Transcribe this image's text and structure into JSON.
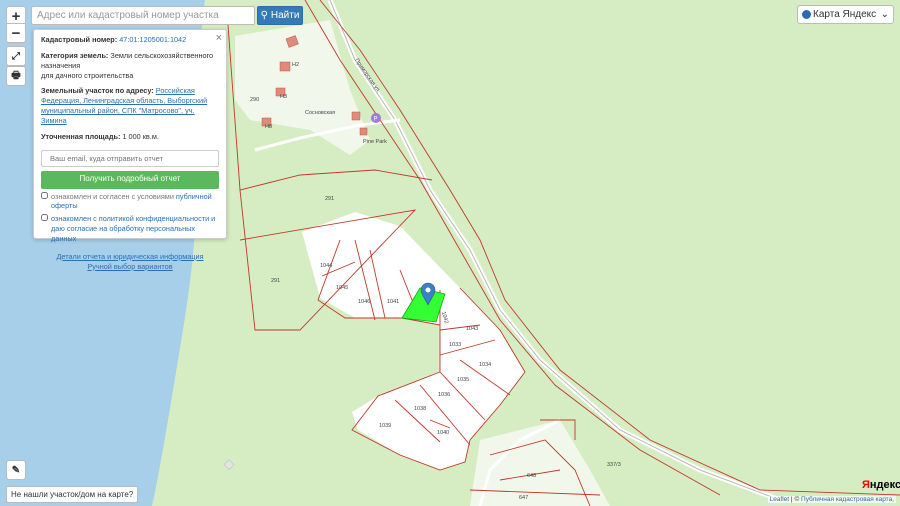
{
  "search": {
    "placeholder": "Адрес или кадастровый номер участка",
    "button_label": "Найти"
  },
  "zoom": {
    "in": "+",
    "out": "−"
  },
  "layer_selector": {
    "selected": "Карта Яндекс"
  },
  "panel": {
    "cadastral_number_label": "Кадастровый номер:",
    "cadastral_number": "47:01:1205001:1042",
    "category_label": "Категория земель:",
    "category_value": "Земли сельскохозяйственного назначения",
    "category_use": "для дачного строительства",
    "address_label": "Земельный участок по адресу:",
    "address_value": "Российская Федерация, Ленинградская область, Выборгский муниципальный район, СПК \"Матросово\", уч. Зимина",
    "area_label": "Уточненная площадь:",
    "area_value": "1 000 кв.м.",
    "email_placeholder": "Ваш email, куда отправить отчет",
    "report_button": "Получить подробный отчет",
    "checkbox1_text": "ознакомлен и согласен с условиями",
    "checkbox1_link": "публичной оферты",
    "checkbox2_text": "ознакомлен с политикой конфиденциальности и даю согласие на обработку персональных данных",
    "link_details": "Детали отчета и юридическая информация",
    "link_manual": "Ручной выбор вариантов"
  },
  "not_found_button": "Не нашли участок/дом на карте?",
  "attribution": {
    "leaflet": "Leaflet",
    "sep": "|",
    "pkk": "Публичная кадастровая карта,",
    "copy": "©"
  },
  "yandex_logo": {
    "first": "Я",
    "rest": "ндекс"
  },
  "map": {
    "street_labels": [
      "Сосновская",
      "Приморская ул."
    ],
    "poi_label": "Pine Park",
    "parcel_labels": {
      "p1044": "1044",
      "p1045": "1045",
      "p1046": "1046",
      "p1041": "1041",
      "p1042": "1042",
      "p1043": "1043",
      "p1033": "1033",
      "p1034": "1034",
      "p1035": "1035",
      "p1036": "1036",
      "p1038": "1038",
      "p1039": "1039",
      "p1040": "1040",
      "p291a": "291",
      "p291b": "291",
      "p290": "290",
      "p648": "648",
      "p647": "647",
      "p3373": "337/3",
      "pn2": "Н2",
      "pn3": "Н3",
      "pn8": "Н8"
    }
  },
  "colors": {
    "water": "#a7cfe9",
    "land": "#d6ecc2",
    "selected_parcel": "#33ff33",
    "boundary": "#c0392b",
    "marker": "#3b7fc4"
  }
}
